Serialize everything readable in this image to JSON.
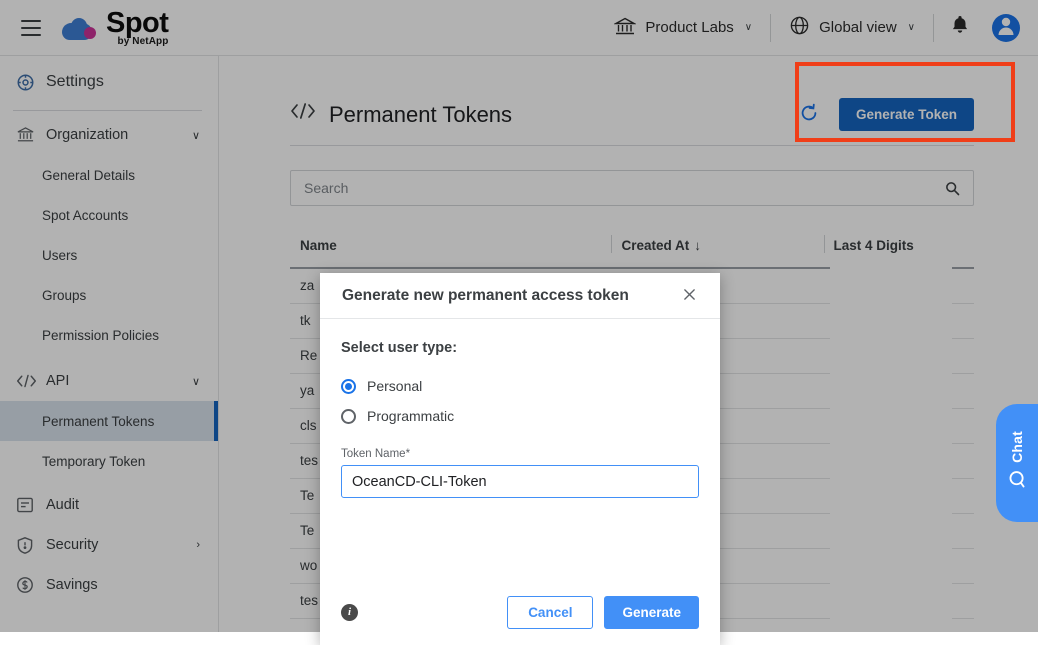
{
  "topbar": {
    "brand_name": "Spot",
    "brand_sub": "by NetApp",
    "menu_icon": "hamburger-icon",
    "account_selector": {
      "label": "Product Labs",
      "icon": "bank-icon",
      "caret": "∨"
    },
    "view_selector": {
      "label": "Global view",
      "icon": "globe-icon",
      "caret": "∨"
    },
    "notifications_icon": "bell-icon",
    "avatar_icon": "user-avatar-icon"
  },
  "sidebar": {
    "settings": {
      "label": "Settings",
      "icon": "gear-icon"
    },
    "groups": [
      {
        "label": "Organization",
        "icon": "bank-icon",
        "caret": "∨",
        "expanded": true,
        "items": [
          {
            "label": "General Details",
            "active": false
          },
          {
            "label": "Spot Accounts",
            "active": false
          },
          {
            "label": "Users",
            "active": false
          },
          {
            "label": "Groups",
            "active": false
          },
          {
            "label": "Permission Policies",
            "active": false
          }
        ]
      },
      {
        "label": "API",
        "icon": "code-icon",
        "caret": "∨",
        "expanded": true,
        "items": [
          {
            "label": "Permanent Tokens",
            "active": true
          },
          {
            "label": "Temporary Token",
            "active": false
          }
        ]
      }
    ],
    "bottom_items": [
      {
        "label": "Audit",
        "icon": "audit-icon",
        "caret": ""
      },
      {
        "label": "Security",
        "icon": "shield-icon",
        "caret": "›"
      },
      {
        "label": "Savings",
        "icon": "dollar-circle-icon",
        "caret": ""
      }
    ]
  },
  "page": {
    "title": "Permanent Tokens",
    "title_icon": "code-icon",
    "refresh_icon": "refresh-icon",
    "generate_token_label": "Generate Token"
  },
  "search": {
    "placeholder": "Search",
    "value": "",
    "icon": "search-icon"
  },
  "table": {
    "columns": [
      {
        "key": "name",
        "label": "Name",
        "sorted": false
      },
      {
        "key": "created_at",
        "label": "Created At",
        "sorted": true,
        "sort_arrow": "↓"
      },
      {
        "key": "last4",
        "label": "Last 4 Digits",
        "sorted": false
      }
    ],
    "rows": [
      {
        "name": "za",
        "created_at": "",
        "last4": ""
      },
      {
        "name": "tk",
        "created_at": "",
        "last4": ""
      },
      {
        "name": "Re",
        "created_at": "",
        "last4": ""
      },
      {
        "name": "ya",
        "created_at": "",
        "last4": ""
      },
      {
        "name": "cls",
        "created_at": "",
        "last4": ""
      },
      {
        "name": "tes",
        "created_at": "",
        "last4": ""
      },
      {
        "name": "Te",
        "created_at": "",
        "last4": ""
      },
      {
        "name": "Te",
        "created_at": "",
        "last4": ""
      },
      {
        "name": "wo",
        "created_at": "",
        "last4": ""
      },
      {
        "name": "tes",
        "created_at": "",
        "last4": ""
      }
    ]
  },
  "chat_widget": {
    "label": "Chat",
    "icon": "chat-search-icon"
  },
  "annotation": {
    "color": "#f03e18",
    "target": "generate-token-button"
  },
  "modal": {
    "title": "Generate new permanent access token",
    "close_icon": "close-icon",
    "user_type_legend": "Select user type:",
    "user_type_options": [
      {
        "label": "Personal",
        "selected": true
      },
      {
        "label": "Programmatic",
        "selected": false
      }
    ],
    "token_name_label": "Token Name",
    "token_name_required_mark": "*",
    "token_name_value": "OceanCD-CLI-Token",
    "token_name_placeholder": "",
    "info_icon": "info-icon",
    "cancel_label": "Cancel",
    "generate_label": "Generate"
  },
  "colors": {
    "accent_blue": "#4290f7",
    "primary_blue": "#1565c0",
    "annotation_red": "#f03e18",
    "sidebar_active": "#d9e2ec"
  }
}
